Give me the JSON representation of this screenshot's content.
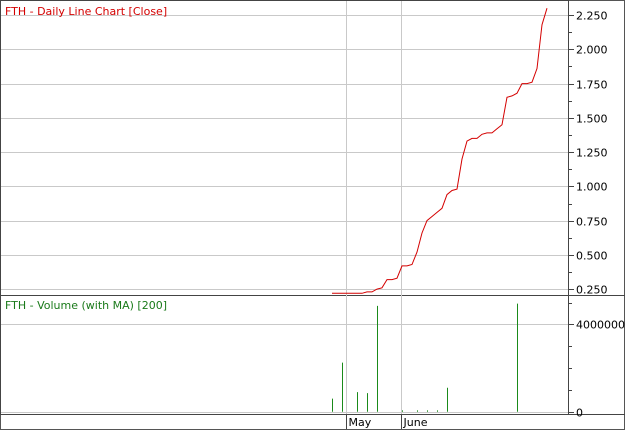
{
  "chart_data": [
    {
      "type": "line",
      "title": "FTH - Daily Line Chart [Close]",
      "title_color": "#d40000",
      "line_color": "#d40000",
      "xlabel": "",
      "ylabel": "",
      "y_tick_labels": [
        "0.250",
        "0.500",
        "0.750",
        "1.000",
        "1.250",
        "1.500",
        "1.750",
        "2.000",
        "2.250"
      ],
      "ylim": [
        0.2,
        2.36
      ],
      "grid": true,
      "x_tick_labels": [
        "May",
        "June"
      ],
      "series": [
        {
          "points": [
            [
              0,
              0.22
            ],
            [
              2,
              0.22
            ],
            [
              3,
              0.22
            ],
            [
              4,
              0.22
            ],
            [
              5,
              0.22
            ],
            [
              6,
              0.22
            ],
            [
              7,
              0.23
            ],
            [
              8,
              0.23
            ],
            [
              9,
              0.25
            ],
            [
              10,
              0.26
            ],
            [
              11,
              0.32
            ],
            [
              12,
              0.32
            ],
            [
              13,
              0.33
            ],
            [
              14,
              0.42
            ],
            [
              15,
              0.42
            ],
            [
              16,
              0.43
            ],
            [
              17,
              0.52
            ],
            [
              18,
              0.66
            ],
            [
              19,
              0.75
            ],
            [
              20,
              0.78
            ],
            [
              21,
              0.81
            ],
            [
              22,
              0.84
            ],
            [
              23,
              0.94
            ],
            [
              24,
              0.97
            ],
            [
              25,
              0.98
            ],
            [
              26,
              1.2
            ],
            [
              27,
              1.33
            ],
            [
              28,
              1.35
            ],
            [
              29,
              1.35
            ],
            [
              30,
              1.38
            ],
            [
              31,
              1.39
            ],
            [
              32,
              1.39
            ],
            [
              33,
              1.42
            ],
            [
              34,
              1.45
            ],
            [
              35,
              1.65
            ],
            [
              36,
              1.66
            ],
            [
              37,
              1.68
            ],
            [
              38,
              1.75
            ],
            [
              39,
              1.75
            ],
            [
              40,
              1.76
            ],
            [
              41,
              1.86
            ],
            [
              42,
              2.18
            ],
            [
              43,
              2.3
            ]
          ]
        }
      ]
    },
    {
      "type": "bar",
      "title": "FTH - Volume (with MA) [200]",
      "title_color": "#1a7a1a",
      "bar_color": "#1a8a1a",
      "xlabel": "",
      "ylabel": "",
      "y_tick_labels": [
        "0",
        "4000000"
      ],
      "ylim": [
        -150000,
        5300000
      ],
      "grid": true,
      "x_tick_labels": [
        "May",
        "June"
      ],
      "series": [
        {
          "points": [
            [
              0,
              600000
            ],
            [
              2,
              2250000
            ],
            [
              5,
              900000
            ],
            [
              7,
              850000
            ],
            [
              9,
              4850000
            ],
            [
              14,
              60000
            ],
            [
              17,
              60000
            ],
            [
              19,
              60000
            ],
            [
              21,
              60000
            ],
            [
              23,
              1100000
            ],
            [
              37,
              4950000
            ]
          ]
        }
      ]
    }
  ]
}
